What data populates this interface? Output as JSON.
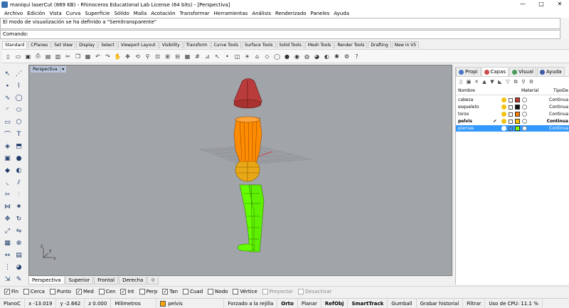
{
  "window": {
    "title": "maniquí laserCut (869 KB) - Rhinoceros Educational Lab License (64 bits) - [Perspectiva]",
    "controls": [
      "—",
      "□",
      "✕"
    ]
  },
  "menu": [
    "Archivo",
    "Edición",
    "Vista",
    "Curva",
    "Superficie",
    "Sólido",
    "Malla",
    "Acotación",
    "Transformar",
    "Herramientas",
    "Análisis",
    "Renderizado",
    "Paneles",
    "Ayuda"
  ],
  "command": {
    "history": "El modo de visualización se ha definido a \"Semitransparente\"",
    "prompt_label": "Comando:",
    "value": ""
  },
  "toolbar_tabs": [
    "Standard",
    "CPlanes",
    "Set View",
    "Display",
    "Select",
    "Viewport Layout",
    "Visibility",
    "Transform",
    "Curve Tools",
    "Surface Tools",
    "Solid Tools",
    "Mesh Tools",
    "Render Tools",
    "Drafting",
    "New in V5"
  ],
  "active_toolbar_tab": 0,
  "toolbar_icons": [
    {
      "name": "new-file-icon",
      "glyph": "▯"
    },
    {
      "name": "open-file-icon",
      "glyph": "▭"
    },
    {
      "name": "save-icon",
      "glyph": "▣"
    },
    {
      "name": "print-icon",
      "glyph": "⎙"
    },
    {
      "name": "import-icon",
      "glyph": "▤"
    },
    {
      "name": "properties-icon",
      "glyph": "▥"
    },
    {
      "name": "cut-icon",
      "glyph": "✂"
    },
    {
      "name": "copy-icon",
      "glyph": "❐"
    },
    {
      "name": "paste-icon",
      "glyph": "▦"
    },
    {
      "name": "undo-icon",
      "glyph": "↶"
    },
    {
      "name": "redo-icon",
      "glyph": "↷"
    },
    {
      "name": "hand-icon",
      "glyph": "✋"
    },
    {
      "name": "pan-icon",
      "glyph": "✥"
    },
    {
      "name": "rotate-view-icon",
      "glyph": "⟲"
    },
    {
      "name": "zoom-icon",
      "glyph": "⚲"
    },
    {
      "name": "zoom-window-icon",
      "glyph": "⊡"
    },
    {
      "name": "zoom-extents-icon",
      "glyph": "⊞"
    },
    {
      "name": "zoom-selected-icon",
      "glyph": "⊟"
    },
    {
      "name": "four-views-icon",
      "glyph": "▦"
    },
    {
      "name": "grid-icon",
      "glyph": "#"
    },
    {
      "name": "cplane-icon",
      "glyph": "⊿"
    },
    {
      "name": "select-icon",
      "glyph": "↖"
    },
    {
      "name": "point-icon",
      "glyph": "•"
    },
    {
      "name": "layers-icon",
      "glyph": "◫"
    },
    {
      "name": "light-icon",
      "glyph": "☀"
    },
    {
      "name": "lock-icon",
      "glyph": "⌂"
    },
    {
      "name": "object-props-icon",
      "glyph": "◇"
    },
    {
      "name": "wireframe-icon",
      "glyph": "◯"
    },
    {
      "name": "shaded-icon",
      "glyph": "●"
    },
    {
      "name": "rendered-icon",
      "glyph": "◉"
    },
    {
      "name": "ghosted-icon",
      "glyph": "◍"
    },
    {
      "name": "render-icon",
      "glyph": "◕"
    },
    {
      "name": "material-icon",
      "glyph": "◐"
    },
    {
      "name": "sun-icon",
      "glyph": "✺"
    },
    {
      "name": "options-icon",
      "glyph": "⚙"
    },
    {
      "name": "help-icon",
      "glyph": "?"
    }
  ],
  "left_tools": [
    {
      "name": "select-arrow-icon",
      "glyph": "↖"
    },
    {
      "name": "select-points-icon",
      "glyph": "⋰"
    },
    {
      "name": "point-tool-icon",
      "glyph": "∙"
    },
    {
      "name": "polyline-icon",
      "glyph": "⌇"
    },
    {
      "name": "curve-icon",
      "glyph": "∿"
    },
    {
      "name": "circle-icon",
      "glyph": "◯"
    },
    {
      "name": "arc-icon",
      "glyph": "◜"
    },
    {
      "name": "ellipse-icon",
      "glyph": "⬭"
    },
    {
      "name": "rectangle-icon",
      "glyph": "▭"
    },
    {
      "name": "polygon-icon",
      "glyph": "⬡"
    },
    {
      "name": "freeform-icon",
      "glyph": "⌒"
    },
    {
      "name": "text-icon",
      "glyph": "T"
    },
    {
      "name": "surface-icon",
      "glyph": "◈"
    },
    {
      "name": "extrude-icon",
      "glyph": "⬒"
    },
    {
      "name": "box-icon",
      "glyph": "▣"
    },
    {
      "name": "sphere-icon",
      "glyph": "●"
    },
    {
      "name": "mesh-icon",
      "glyph": "◆"
    },
    {
      "name": "boolean-icon",
      "glyph": "◐"
    },
    {
      "name": "fillet-icon",
      "glyph": "◟"
    },
    {
      "name": "offset-icon",
      "glyph": "⫽"
    },
    {
      "name": "trim-icon",
      "glyph": "✂"
    },
    {
      "name": "split-icon",
      "glyph": "⫶"
    },
    {
      "name": "join-icon",
      "glyph": "⋈"
    },
    {
      "name": "explode-icon",
      "glyph": "✷"
    },
    {
      "name": "move-icon",
      "glyph": "✥"
    },
    {
      "name": "rotate-icon",
      "glyph": "↻"
    },
    {
      "name": "scale-icon",
      "glyph": "⤢"
    },
    {
      "name": "mirror-icon",
      "glyph": "⇋"
    },
    {
      "name": "array-icon",
      "glyph": "▦"
    },
    {
      "name": "analyze-icon",
      "glyph": "⊕"
    },
    {
      "name": "dimension-icon",
      "glyph": "↔"
    },
    {
      "name": "block-icon",
      "glyph": "▤"
    },
    {
      "name": "grid-snap-icon",
      "glyph": "⋮"
    },
    {
      "name": "render-preview-icon",
      "glyph": "◕"
    },
    {
      "name": "transform-icon",
      "glyph": "⇲"
    },
    {
      "name": "drafting-icon",
      "glyph": "✎"
    }
  ],
  "viewport": {
    "title": "Perspectiva",
    "axis_x": "x",
    "axis_y": "y",
    "axis_z": "z"
  },
  "viewport_tabs": [
    "Perspectiva",
    "Superior",
    "Frontal",
    "Derecha",
    "⟐"
  ],
  "active_viewport_tab": 0,
  "osnaps": [
    {
      "label": "Fin",
      "checked": true
    },
    {
      "label": "Cerca",
      "checked": false
    },
    {
      "label": "Punto",
      "checked": false
    },
    {
      "label": "Med",
      "checked": true
    },
    {
      "label": "Cen",
      "checked": false
    },
    {
      "label": "Int",
      "checked": true
    },
    {
      "label": "Perp",
      "checked": false
    },
    {
      "label": "Tan",
      "checked": true
    },
    {
      "label": "Cuad",
      "checked": false
    },
    {
      "label": "Nodo",
      "checked": false
    },
    {
      "label": "Vértice",
      "checked": false
    },
    {
      "label": "Proyectar",
      "checked": false,
      "disabled": true
    },
    {
      "label": "Desactivar",
      "checked": false,
      "disabled": true
    }
  ],
  "status": {
    "cplane": "PlanoC",
    "x": "x -13.019",
    "y": "y -2.662",
    "z": "z 0.000",
    "units": "Milímetros",
    "layer_name": "pelvis",
    "layer_color": "#ffa500",
    "buttons": [
      {
        "label": "Forzado a la rejilla",
        "bold": false
      },
      {
        "label": "Orto",
        "bold": true
      },
      {
        "label": "Planar",
        "bold": false
      },
      {
        "label": "RefObj",
        "bold": true
      },
      {
        "label": "SmartTrack",
        "bold": true
      },
      {
        "label": "Gumball",
        "bold": false
      },
      {
        "label": "Grabar historial",
        "bold": false
      },
      {
        "label": "Filtrar",
        "bold": false
      },
      {
        "label": "Uso de CPU: 11.1 %",
        "bold": false
      }
    ]
  },
  "panel": {
    "tabs": [
      {
        "label": "Propi",
        "color": "#4a76c6"
      },
      {
        "label": "Capas",
        "color": "#c94b4b"
      },
      {
        "label": "Visual",
        "color": "#4a9a5b"
      },
      {
        "label": "Ayuda",
        "color": "#3b5aa5"
      }
    ],
    "active_tab": 1,
    "tool_icons": [
      "▯",
      "▣",
      "✕",
      "▲",
      "▼",
      "◣",
      "▽",
      "⧉",
      "⚲",
      "⚙"
    ],
    "col_name": "Nombre",
    "col_material": "Material",
    "col_type": "TipoDe",
    "layers": [
      {
        "name": "cabeza",
        "color": "#c0392b",
        "type": "Continua",
        "current": false,
        "selected": false
      },
      {
        "name": "esqueleto",
        "color": "#111111",
        "type": "Continua",
        "current": false,
        "selected": false
      },
      {
        "name": "torso",
        "color": "#ff7a00",
        "type": "Continua",
        "current": false,
        "selected": false
      },
      {
        "name": "pelvis",
        "color": "#ffc000",
        "type": "Continua",
        "current": true,
        "selected": false
      },
      {
        "name": "piernas",
        "color": "#7cff00",
        "type": "Continua",
        "current": false,
        "selected": true
      }
    ]
  },
  "colors": {
    "viewport_bg": "#a1a4a8",
    "head": "#b93c3a",
    "torso": "#ff8c00",
    "pelvis": "#e8a716",
    "legs": "#66ff00",
    "selection": "#3399ff"
  }
}
